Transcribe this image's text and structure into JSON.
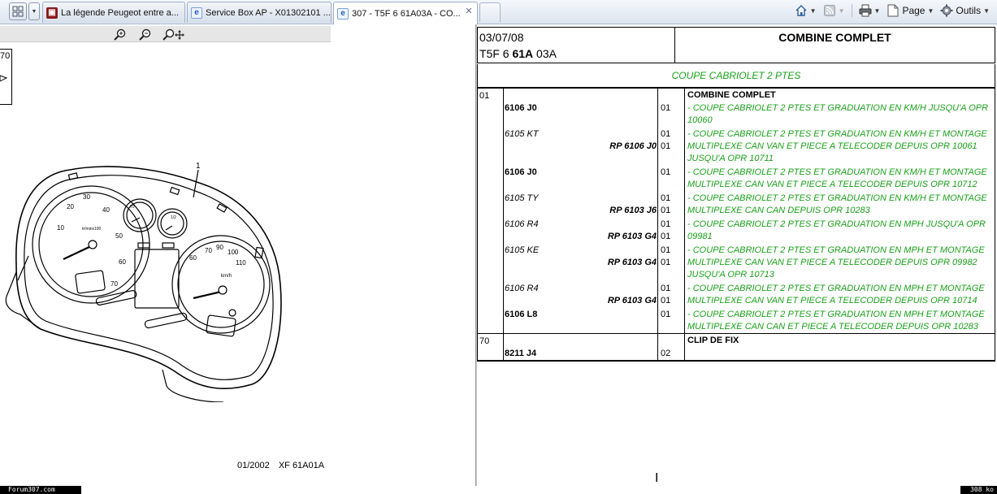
{
  "browser": {
    "tabs": [
      {
        "label": "La légende Peugeot entre a...",
        "favicon": "forum-icon"
      },
      {
        "label": "Service Box AP - X01302101 ...",
        "favicon": "ie-icon"
      },
      {
        "label": "307 - T5F 6 61A03A - CO...",
        "favicon": "ie-icon",
        "active": true
      }
    ],
    "commands": {
      "page_label": "Page",
      "tools_label": "Outils"
    }
  },
  "left_pane": {
    "ref_box_number": "70",
    "callout_number": "1",
    "gauge_labels": {
      "tacho": [
        "10",
        "20",
        "30",
        "40",
        "50",
        "60",
        "70"
      ],
      "tacho_unit": "tr/minx100",
      "speedo": [
        "60",
        "70",
        "80",
        "90",
        "100",
        "110"
      ],
      "speedo_unit": "km/h",
      "temp": "70",
      "fuel": "1/2"
    },
    "caption": {
      "date": "01/2002",
      "code": "XF 61A01A"
    }
  },
  "right_pane": {
    "header": {
      "date": "03/07/08",
      "code_prefix": "T5F 6",
      "code_bold": "61A",
      "code_suffix": "03A",
      "title": "COMBINE COMPLET"
    },
    "band": "COUPE CABRIOLET 2 PTES",
    "groups": [
      {
        "number": "01",
        "title": "COMBINE COMPLET",
        "rows": [
          {
            "ref": "6106 J0",
            "style": "bold",
            "qty": "01",
            "desc": "- COUPE CABRIOLET 2 PTES ET GRADUATION EN KM/H JUSQU'A OPR 10060"
          },
          {
            "ref": "6105 KT",
            "style": "italic",
            "qty": "01",
            "desc": "- COUPE CABRIOLET 2 PTES ET GRADUATION EN KM/H ET MONTAGE MULTIPLEXE CAN VAN ET PIECE A TELECODER DEPUIS OPR 10061 JUSQU'A OPR 10711"
          },
          {
            "rp": "RP 6106 J0",
            "qty": "01"
          },
          {
            "ref": "6106 J0",
            "style": "bold",
            "qty": "01",
            "desc": "- COUPE CABRIOLET 2 PTES ET GRADUATION EN KM/H ET MONTAGE MULTIPLEXE CAN VAN ET PIECE A TELECODER DEPUIS OPR 10712"
          },
          {
            "ref": "6105 TY",
            "style": "italic",
            "qty": "01",
            "desc": "- COUPE CABRIOLET 2 PTES ET GRADUATION EN KM/H ET MONTAGE MULTIPLEXE CAN CAN DEPUIS OPR 10283"
          },
          {
            "rp": "RP 6103 J6",
            "qty": "01"
          },
          {
            "ref": "6106 R4",
            "style": "italic",
            "qty": "01",
            "desc": "- COUPE CABRIOLET 2 PTES ET GRADUATION EN MPH JUSQU'A OPR 09981"
          },
          {
            "rp": "RP 6103 G4",
            "qty": "01"
          },
          {
            "ref": "6105 KE",
            "style": "italic",
            "qty": "01",
            "desc": "- COUPE CABRIOLET 2 PTES ET GRADUATION EN MPH ET MONTAGE MULTIPLEXE CAN VAN ET PIECE A TELECODER DEPUIS OPR 09982 JUSQU'A OPR 10713"
          },
          {
            "rp": "RP 6103 G4",
            "qty": "01"
          },
          {
            "ref": "6106 R4",
            "style": "italic",
            "qty": "01",
            "desc": "- COUPE CABRIOLET 2 PTES ET GRADUATION EN MPH ET MONTAGE MULTIPLEXE CAN VAN ET PIECE A TELECODER DEPUIS OPR 10714"
          },
          {
            "rp": "RP 6103 G4",
            "qty": "01"
          },
          {
            "ref": "6106 L8",
            "style": "bold",
            "qty": "01",
            "desc": "- COUPE CABRIOLET 2 PTES ET GRADUATION EN MPH ET MONTAGE MULTIPLEXE CAN CAN ET PIECE A TELECODER DEPUIS OPR 10283"
          }
        ]
      },
      {
        "number": "70",
        "title": "CLIP DE FIX",
        "rows": [
          {
            "ref": "8211 J4",
            "style": "bold",
            "qty": "02",
            "desc": ""
          }
        ]
      }
    ]
  },
  "watermark": {
    "left": "Forum307.com",
    "right": "308 ko"
  },
  "colors": {
    "accent_green": "#1aa11a",
    "tab_active_bg": "#ffffff",
    "chrome_bg": "#dde5ef"
  }
}
